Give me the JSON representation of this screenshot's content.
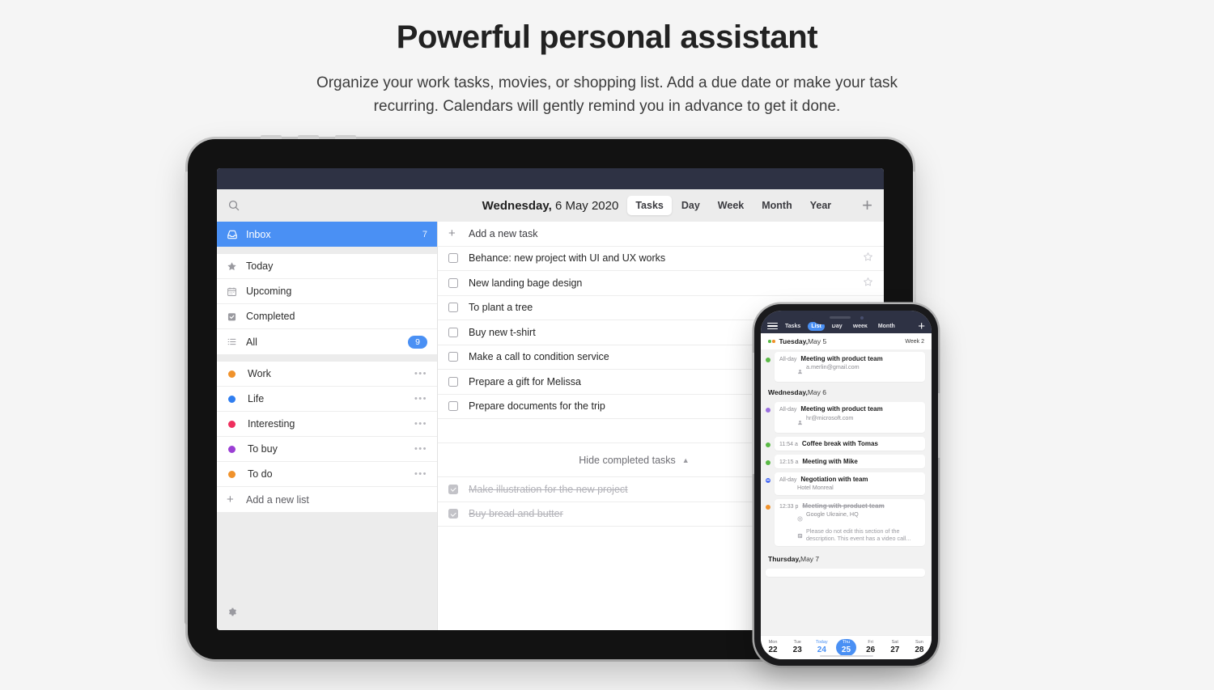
{
  "hero": {
    "title": "Powerful personal assistant",
    "subtitle": "Organize your work tasks, movies, or shopping list. Add a due date or make your task recurring. Calendars will gently remind you in advance to get it done."
  },
  "colors": {
    "accent_blue": "#4a90f4",
    "status_bar": "#2e3244",
    "page_background": "#f5f5f5",
    "list_work": "#f0922b",
    "list_life": "#2f7ef0",
    "list_interesting": "#ef2f5e",
    "list_tobuy": "#9b3fd4",
    "list_todo": "#f0922b"
  },
  "tablet": {
    "toolbar": {
      "search_icon": "search-icon",
      "date_weekday": "Wednesday,",
      "date_rest": " 6 May 2020",
      "segments": [
        {
          "label": "Tasks",
          "active": true
        },
        {
          "label": "Day",
          "active": false
        },
        {
          "label": "Week",
          "active": false
        },
        {
          "label": "Month",
          "active": false
        },
        {
          "label": "Year",
          "active": false
        }
      ],
      "add_icon": "plus-icon"
    },
    "sidebar": {
      "smart_lists": [
        {
          "label": "Inbox",
          "icon": "inbox-icon",
          "count": "7",
          "selected": true,
          "badge": false
        },
        {
          "label": "Today",
          "icon": "star-icon",
          "count": "",
          "selected": false,
          "badge": false
        },
        {
          "label": "Upcoming",
          "icon": "calendar-icon",
          "count": "",
          "selected": false,
          "badge": false
        },
        {
          "label": "Completed",
          "icon": "check-box-icon",
          "count": "",
          "selected": false,
          "badge": false
        },
        {
          "label": "All",
          "icon": "list-icon",
          "count": "9",
          "selected": false,
          "badge": true
        }
      ],
      "user_lists": [
        {
          "label": "Work",
          "color": "#f0922b",
          "menu_icon": "ellipsis-icon"
        },
        {
          "label": "Life",
          "color": "#2f7ef0",
          "menu_icon": "ellipsis-icon"
        },
        {
          "label": "Interesting",
          "color": "#ef2f5e",
          "menu_icon": "ellipsis-icon"
        },
        {
          "label": "To buy",
          "color": "#9b3fd4",
          "menu_icon": "ellipsis-icon"
        },
        {
          "label": "To do",
          "color": "#f0922b",
          "menu_icon": "ellipsis-icon"
        }
      ],
      "add_list_label": "Add a new list",
      "add_list_icon": "plus-icon",
      "settings_icon": "gear-icon"
    },
    "tasks": {
      "add_task_label": "Add a new task",
      "add_task_icon": "plus-icon",
      "open": [
        {
          "text": "Behance: new project with UI and UX works",
          "star": true
        },
        {
          "text": "New landing bage design",
          "star": true
        },
        {
          "text": "To plant a tree",
          "star": true
        },
        {
          "text": "Buy new t-shirt",
          "star": false
        },
        {
          "text": "Make a call to condition service",
          "star": false
        },
        {
          "text": "Prepare a gift for Melissa",
          "star": false
        },
        {
          "text": "Prepare documents for the trip",
          "star": false
        }
      ],
      "hide_completed_label": "Hide completed tasks",
      "hide_completed_icon": "caret-up-icon",
      "completed": [
        {
          "text": "Make illustration for the new project"
        },
        {
          "text": "Buy bread and butter"
        }
      ]
    }
  },
  "phone": {
    "topbar": {
      "menu_icon": "hamburger-icon",
      "segments": [
        {
          "label": "Tasks",
          "active": false
        },
        {
          "label": "List",
          "active": true
        },
        {
          "label": "Day",
          "active": false
        },
        {
          "label": "Week",
          "active": false
        },
        {
          "label": "Month",
          "active": false
        }
      ],
      "add_icon": "plus-icon"
    },
    "days": [
      {
        "weekday": "Tuesday,",
        "date": " May 5",
        "week": "Week 2",
        "header_dots": [
          "#5aba46",
          "#f0922b"
        ],
        "highlighted": true,
        "events": [
          {
            "dot": "#5aba46",
            "dot_style": "solid",
            "time": "All-day",
            "title": "Meeting with product team",
            "done": false,
            "details": [
              {
                "icon": "person-icon",
                "text": "a.merlin@gmail.com"
              }
            ]
          }
        ]
      },
      {
        "weekday": "Wednesday,",
        "date": " May 6",
        "week": "",
        "header_dots": [],
        "highlighted": false,
        "events": [
          {
            "dot": "#9b6fe0",
            "dot_style": "solid",
            "time": "All-day",
            "title": "Meeting with product team",
            "done": false,
            "details": [
              {
                "icon": "person-icon",
                "text": "hr@microsoft.com"
              }
            ]
          },
          {
            "dot": "#5aba46",
            "dot_style": "solid",
            "time": "11:54 a",
            "title": "Coffee break with Tomas",
            "done": false,
            "details": []
          },
          {
            "dot": "#5aba46",
            "dot_style": "solid",
            "time": "12:15 a",
            "title": "Meeting with Mike",
            "done": false,
            "details": []
          },
          {
            "dot": "#4a6cf4",
            "dot_style": "tentative",
            "time": "All-day",
            "title": "Negotiation with team",
            "done": false,
            "details": [
              {
                "icon": "none",
                "text": "Hotel Monreal"
              }
            ]
          },
          {
            "dot": "#f0922b",
            "dot_style": "solid",
            "time": "12:33 p",
            "title": "Meeting with product team",
            "done": true,
            "details": [
              {
                "icon": "location-icon",
                "text": "Google Ukraine, HQ"
              },
              {
                "icon": "note-icon",
                "text": "Please do not edit this section of the description. This event has a video call..."
              }
            ]
          }
        ]
      },
      {
        "weekday": "Thursday,",
        "date": " May 7",
        "week": "",
        "header_dots": [],
        "highlighted": false,
        "events": []
      }
    ],
    "date_strip": [
      {
        "name": "Mon",
        "num": "22",
        "today": false,
        "selected": false
      },
      {
        "name": "Tue",
        "num": "23",
        "today": false,
        "selected": false
      },
      {
        "name": "Today",
        "num": "24",
        "today": true,
        "selected": false
      },
      {
        "name": "Thu",
        "num": "25",
        "today": false,
        "selected": true
      },
      {
        "name": "Fri",
        "num": "26",
        "today": false,
        "selected": false
      },
      {
        "name": "Sat",
        "num": "27",
        "today": false,
        "selected": false
      },
      {
        "name": "Sun",
        "num": "28",
        "today": false,
        "selected": false
      }
    ]
  }
}
